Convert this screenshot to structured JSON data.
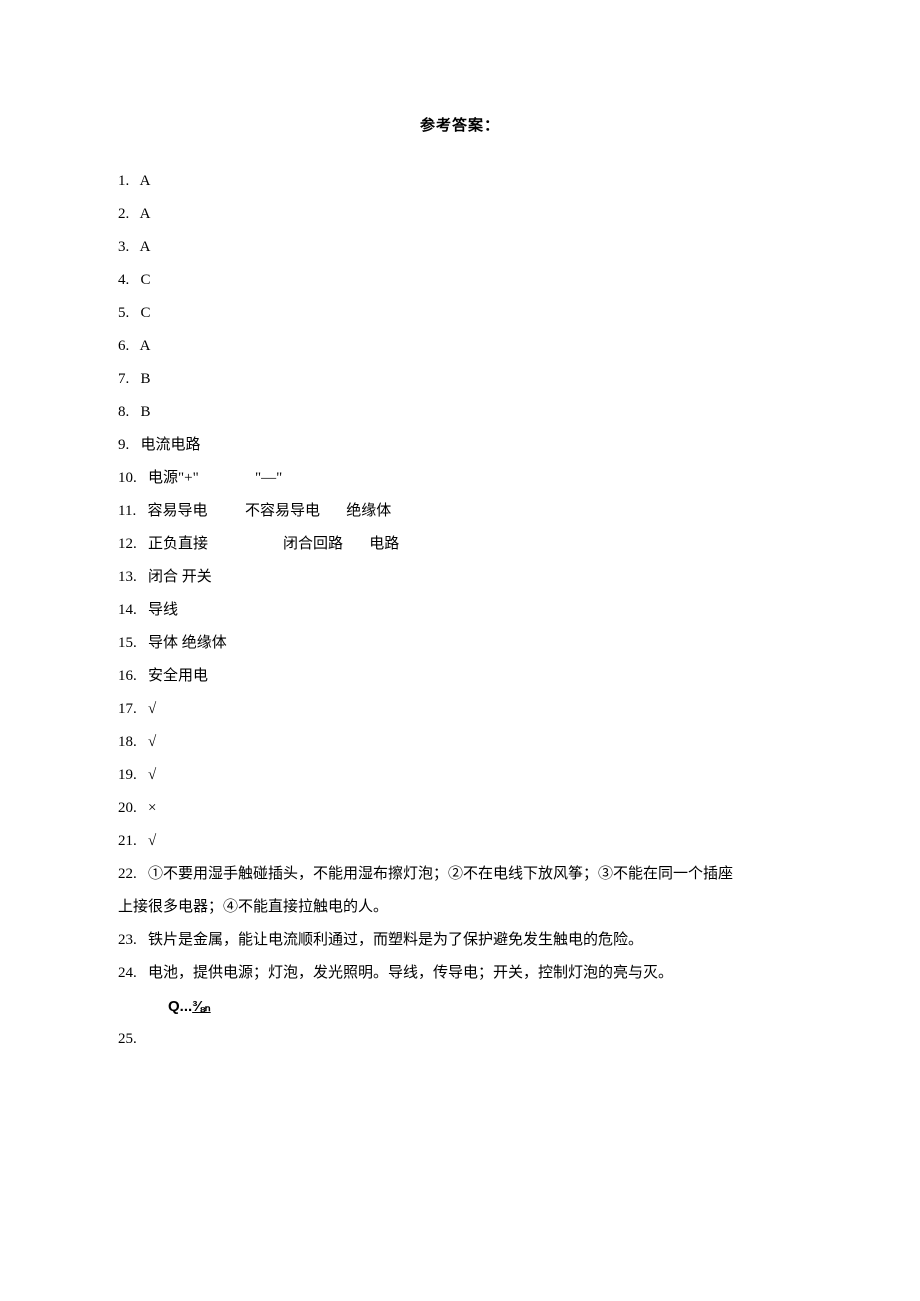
{
  "title": "参考答案：",
  "answers": {
    "a1": "1.   A",
    "a2": "2.   A",
    "a3": "3.   A",
    "a4": "4.   C",
    "a5": "5.   C",
    "a6": "6.   A",
    "a7": "7.   B",
    "a8": "8.   B",
    "a9": "9.   电流电路",
    "a10": "10.   电源\"+\"               \"—\"",
    "a11": "11.   容易导电          不容易导电       绝缘体",
    "a12": "12.   正负直接                    闭合回路       电路",
    "a13": "13.   闭合 开关",
    "a14": "14.   导线",
    "a15": "15.   导体 绝缘体",
    "a16": "16.   安全用电",
    "a17": "17.   √",
    "a18": "18.   √",
    "a19": "19.   √",
    "a20": "20.   ×",
    "a21": "21.   √",
    "a22_line1": "22.   ①不要用湿手触碰插头，不能用湿布擦灯泡；②不在电线下放风筝；③不能在同一个插座",
    "a22_line2": "上接很多电器；④不能直接拉触电的人。",
    "a23": "23.   铁片是金属，能让电流顺利通过，而塑料是为了保护避免发生触电的危险。",
    "a24": "24.   电池，提供电源；灯泡，发光照明。导线，传导电；开关，控制灯泡的亮与灭。",
    "a25_symbol_prefix": "Q...",
    "a25_symbol_under": "⅜ₙ",
    "a25": "25."
  }
}
